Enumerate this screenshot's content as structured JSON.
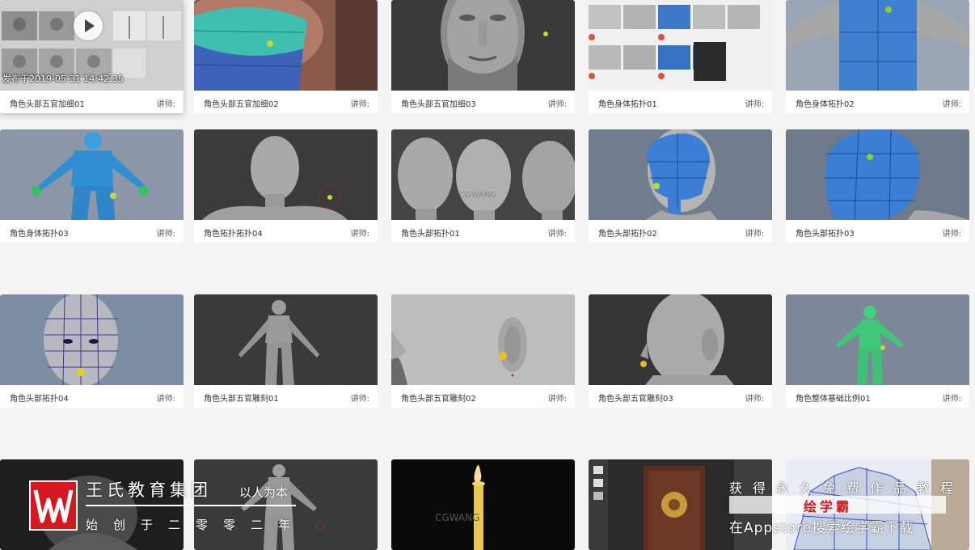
{
  "teacher_label": "讲师:",
  "first_card_overlay": {
    "published": "发布于2019-05-31 14:42:35"
  },
  "cards": [
    {
      "title": "角色头部五官加细01"
    },
    {
      "title": "角色头部五官加细02"
    },
    {
      "title": "角色头部五官加细03"
    },
    {
      "title": "角色身体拓扑01"
    },
    {
      "title": "角色身体拓扑02"
    },
    {
      "title": "角色身体拓扑03"
    },
    {
      "title": "角色拓扑拓扑04"
    },
    {
      "title": "角色头部拓扑01"
    },
    {
      "title": "角色头部拓扑02"
    },
    {
      "title": "角色头部拓扑03"
    },
    {
      "title": "角色头部拓扑04"
    },
    {
      "title": "角色头部五官雕刻01"
    },
    {
      "title": "角色头部五官雕刻02"
    },
    {
      "title": "角色头部五官雕刻03"
    },
    {
      "title": "角色整体基础比例01"
    }
  ],
  "thumb_watermark": "CGWANG",
  "watermark_left": {
    "name": "王氏教育集团",
    "slogan": "以人为本",
    "since": "始创于二零零二年"
  },
  "watermark_right": {
    "line1": "获得永久免费作品教程",
    "brand": "绘学霸",
    "line2": "在Appstore搜索绘学霸下载"
  },
  "colors": {
    "brand_red": "#d6171d",
    "card_bg": "#ffffff",
    "page_bg": "#f4f4f4"
  }
}
